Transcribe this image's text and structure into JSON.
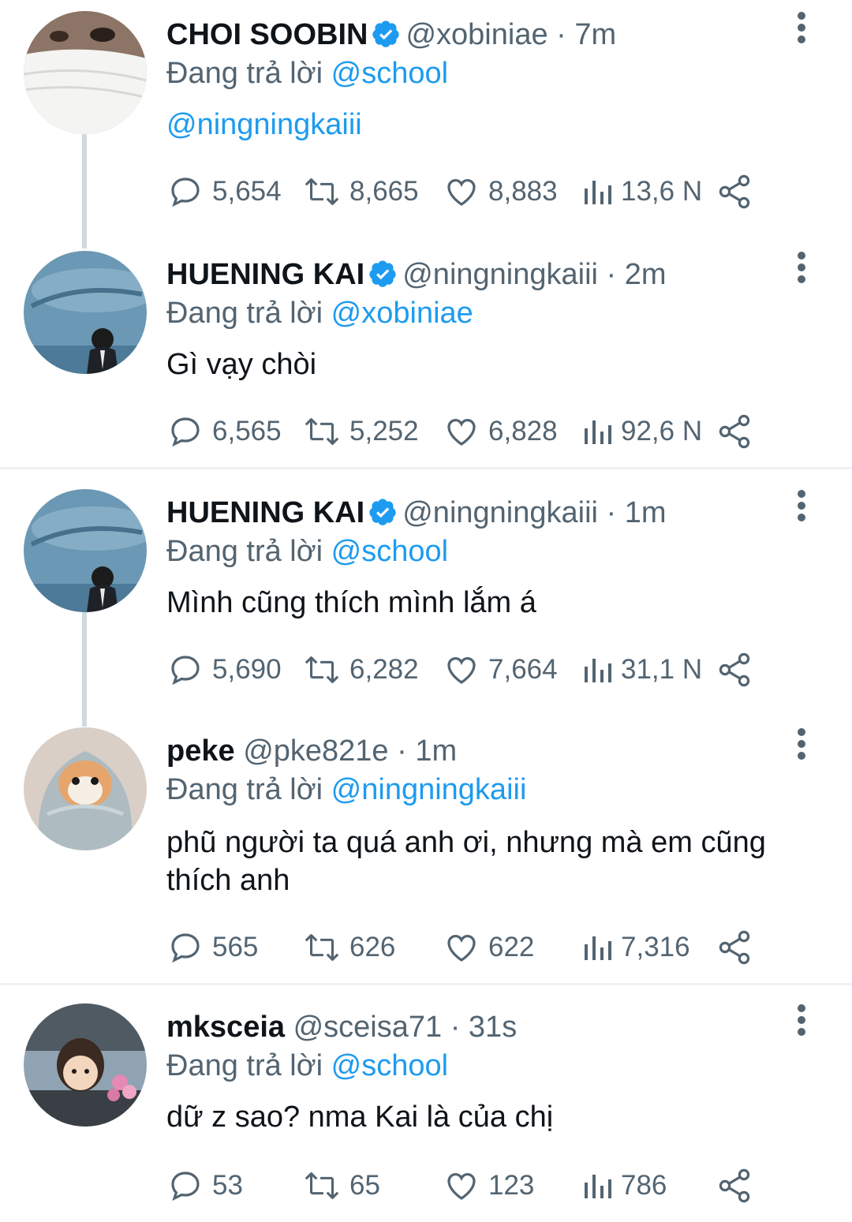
{
  "tweets": [
    {
      "name": "CHOI SOOBIN",
      "verified": true,
      "handle": "@xobiniae",
      "time": "7m",
      "reply_prefix": "Đang trả lời",
      "reply_to": "@school",
      "body": "",
      "body_mention": "@ningningkaiii",
      "replies": "5,654",
      "retweets": "8,665",
      "likes": "8,883",
      "views": "13,6 N"
    },
    {
      "name": "HUENING KAI",
      "verified": true,
      "handle": "@ningningkaiii",
      "time": "2m",
      "reply_prefix": "Đang trả lời",
      "reply_to": "@xobiniae",
      "body": "Gì vạy chòi",
      "replies": "6,565",
      "retweets": "5,252",
      "likes": "6,828",
      "views": "92,6 N"
    },
    {
      "name": "HUENING KAI",
      "verified": true,
      "handle": "@ningningkaiii",
      "time": "1m",
      "reply_prefix": "Đang trả lời",
      "reply_to": "@school",
      "body": "Mình cũng thích mình lắm á",
      "replies": "5,690",
      "retweets": "6,282",
      "likes": "7,664",
      "views": "31,1 N"
    },
    {
      "name": "peke",
      "verified": false,
      "handle": "@pke821e",
      "time": "1m",
      "reply_prefix": "Đang trả lời",
      "reply_to": "@ningningkaiii",
      "body": "phũ người ta quá anh ơi, nhưng mà em cũng thích anh",
      "replies": "565",
      "retweets": "626",
      "likes": "622",
      "views": "7,316"
    },
    {
      "name": "mksceia",
      "verified": false,
      "handle": "@sceisa71",
      "time": "31s",
      "reply_prefix": "Đang trả lời",
      "reply_to": "@school",
      "body": "dữ z sao? nma Kai là của chị",
      "replies": "53",
      "retweets": "65",
      "likes": "123",
      "views": "786"
    }
  ],
  "icons": {
    "reply": "reply-icon",
    "retweet": "retweet-icon",
    "like": "heart-icon",
    "views": "views-icon",
    "share": "share-icon",
    "more": "more-vertical-icon",
    "verified": "verified-badge-icon"
  },
  "colors": {
    "link": "#1d9bf0",
    "muted": "#536471",
    "verified": "#1d9bf0"
  }
}
